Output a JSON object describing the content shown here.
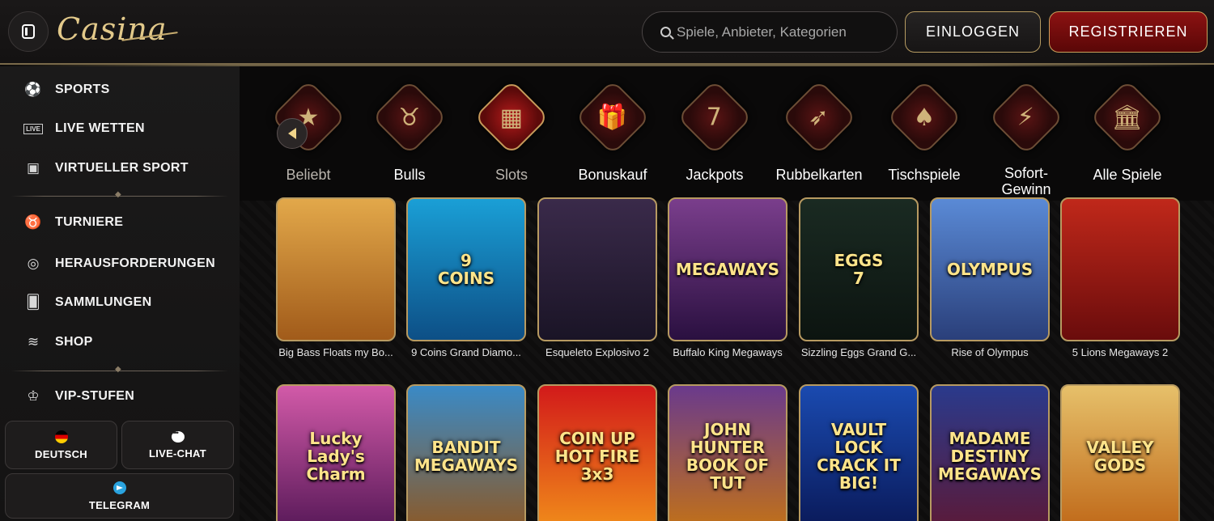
{
  "header": {
    "logo": "Casina",
    "search_placeholder": "Spiele, Anbieter, Kategorien",
    "login_label": "EINLOGGEN",
    "register_label": "REGISTRIEREN"
  },
  "sidebar": {
    "items": [
      {
        "label": "SPORTS",
        "icon": "soccer-ball-icon"
      },
      {
        "label": "LIVE WETTEN",
        "icon": "live-tv-icon"
      },
      {
        "label": "VIRTUELLER SPORT",
        "icon": "virtual-sport-icon"
      },
      {
        "label": "TURNIERE",
        "icon": "bull-icon"
      },
      {
        "label": "HERAUSFORDERUNGEN",
        "icon": "target-icon"
      },
      {
        "label": "SAMMLUNGEN",
        "icon": "cards-icon"
      },
      {
        "label": "SHOP",
        "icon": "coins-icon"
      },
      {
        "label": "VIP-STUFEN",
        "icon": "crown-icon"
      }
    ],
    "language_label": "DEUTSCH",
    "chat_label": "LIVE-CHAT",
    "telegram_label": "TELEGRAM"
  },
  "categories": [
    {
      "label": "Beliebt",
      "icon": "star-icon",
      "glyph": "★"
    },
    {
      "label": "Bulls",
      "icon": "bull-icon",
      "glyph": "♉"
    },
    {
      "label": "Slots",
      "icon": "slot-machine-icon",
      "glyph": "▦",
      "active": true
    },
    {
      "label": "Bonuskauf",
      "icon": "gift-icon",
      "glyph": "🎁"
    },
    {
      "label": "Jackpots",
      "icon": "seven-icon",
      "glyph": "7"
    },
    {
      "label": "Rubbelkarten",
      "icon": "rocket-icon",
      "glyph": "➶"
    },
    {
      "label": "Tischspiele",
      "icon": "playing-cards-icon",
      "glyph": "♠"
    },
    {
      "label": "Sofort-\nGewinn",
      "icon": "lightning-icon",
      "glyph": "⚡"
    },
    {
      "label": "Alle Spiele",
      "icon": "colosseum-icon",
      "glyph": "🏛"
    }
  ],
  "games_row1": [
    {
      "name": "Big Bass Floats my Bo...",
      "art": "",
      "bg": "linear-gradient(180deg,#e2a84a,#a15b1a)"
    },
    {
      "name": "9 Coins Grand Diamo...",
      "art": "9\nCOINS",
      "bg": "linear-gradient(180deg,#1a9fd6,#0d4f86)"
    },
    {
      "name": "Esqueleto Explosivo 2",
      "art": "",
      "bg": "linear-gradient(180deg,#3a2a4a,#1a1426)"
    },
    {
      "name": "Buffalo King Megaways",
      "art": "MEGAWAYS",
      "bg": "linear-gradient(180deg,#7a3e8c,#2a1040)"
    },
    {
      "name": "Sizzling Eggs Grand G...",
      "art": "EGGS\n7",
      "bg": "linear-gradient(180deg,#1a2a22,#0c1410)"
    },
    {
      "name": "Rise of Olympus",
      "art": "OLYMPUS",
      "bg": "linear-gradient(180deg,#5a8ad6,#2a3f7a)"
    },
    {
      "name": "5 Lions Megaways 2",
      "art": "",
      "bg": "linear-gradient(180deg,#c0281a,#6a0c0c)"
    }
  ],
  "games_row2": [
    {
      "name": "Lucky Lady's Charm",
      "art": "Lucky Lady's\nCharm",
      "bg": "linear-gradient(180deg,#d25aa8,#5a1a5a)"
    },
    {
      "name": "Bandit Megaways",
      "art": "BANDIT\nMEGAWAYS",
      "bg": "linear-gradient(180deg,#3a8ac6,#8a5a2a)"
    },
    {
      "name": "Coin Up Hot Fire",
      "art": "COIN UP\nHOT FIRE 3x3",
      "bg": "linear-gradient(180deg,#d21a1a,#f08a1a)"
    },
    {
      "name": "John Hunter and the Book of Tut",
      "art": "JOHN HUNTER\nBOOK OF TUT",
      "bg": "linear-gradient(180deg,#6a3a8c,#c0701a)"
    },
    {
      "name": "Vault Lock Crack It Big",
      "art": "VAULT LOCK\nCRACK IT BIG!",
      "bg": "linear-gradient(180deg,#1a4ab0,#0a1a5a)"
    },
    {
      "name": "Madame Destiny Megaways",
      "art": "MADAME\nDESTINY\nMEGAWAYS",
      "bg": "linear-gradient(180deg,#2a3a8c,#5a1a3a)"
    },
    {
      "name": "Valley of the Gods",
      "art": "VALLEY\nGODS",
      "bg": "linear-gradient(180deg,#e6c06a,#c06a1a)"
    }
  ]
}
